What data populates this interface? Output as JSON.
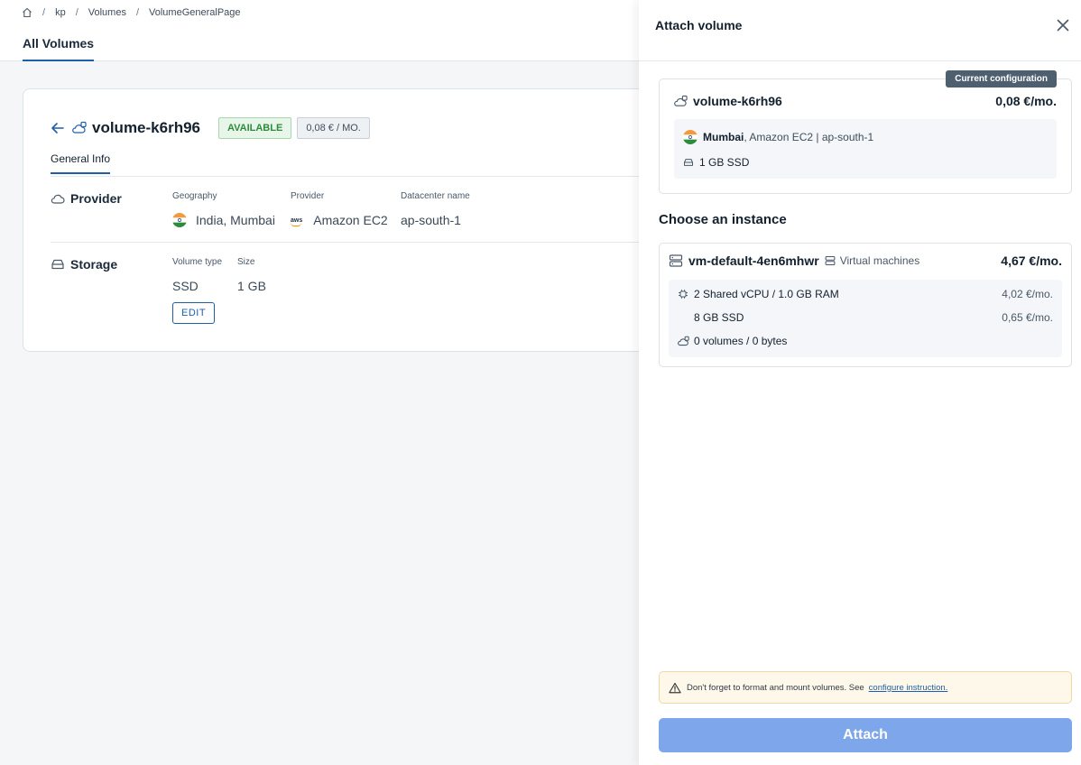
{
  "breadcrumb": {
    "items": [
      "kp",
      "Volumes",
      "VolumeGeneralPage"
    ],
    "separator": "/"
  },
  "page": {
    "tab_label": "All Volumes"
  },
  "volume": {
    "name": "volume-k6rh96",
    "status": "AVAILABLE",
    "price_badge": "0,08 € / MO.",
    "tab_general": "General Info",
    "provider_section": {
      "title": "Provider",
      "geography_label": "Geography",
      "geography_value": "India, Mumbai",
      "provider_label": "Provider",
      "provider_value": "Amazon EC2",
      "provider_logo_text": "aws",
      "datacenter_label": "Datacenter name",
      "datacenter_value": "ap-south-1"
    },
    "storage_section": {
      "title": "Storage",
      "type_label": "Volume type",
      "type_value": "SSD",
      "size_label": "Size",
      "size_value": "1 GB",
      "edit_label": "EDIT"
    }
  },
  "drawer": {
    "title": "Attach volume",
    "current_config": {
      "tag": "Current configuration",
      "name": "volume-k6rh96",
      "price": "0,08 €/mo.",
      "location_city": "Mumbai",
      "location_rest": ", Amazon EC2 | ap-south-1",
      "storage": "1 GB SSD"
    },
    "choose_title": "Choose an instance",
    "instance": {
      "name": "vm-default-4en6mhwr",
      "type": "Virtual machines",
      "price": "4,67 €/mo.",
      "cpu_ram": "2 Shared vCPU / 1.0 GB RAM",
      "cpu_ram_price": "4,02 €/mo.",
      "disk": "8 GB SSD",
      "disk_price": "0,65 €/mo.",
      "volumes": "0 volumes / 0 bytes"
    },
    "warning": {
      "text": "Don't forget to format and mount volumes. See",
      "link": "configure instruction."
    },
    "attach_label": "Attach"
  },
  "colors": {
    "accent": "#1e5fa8",
    "attach_button": "#7da7ea",
    "available_green": "#2e8b3c",
    "warning_bg": "#fef8ea"
  }
}
